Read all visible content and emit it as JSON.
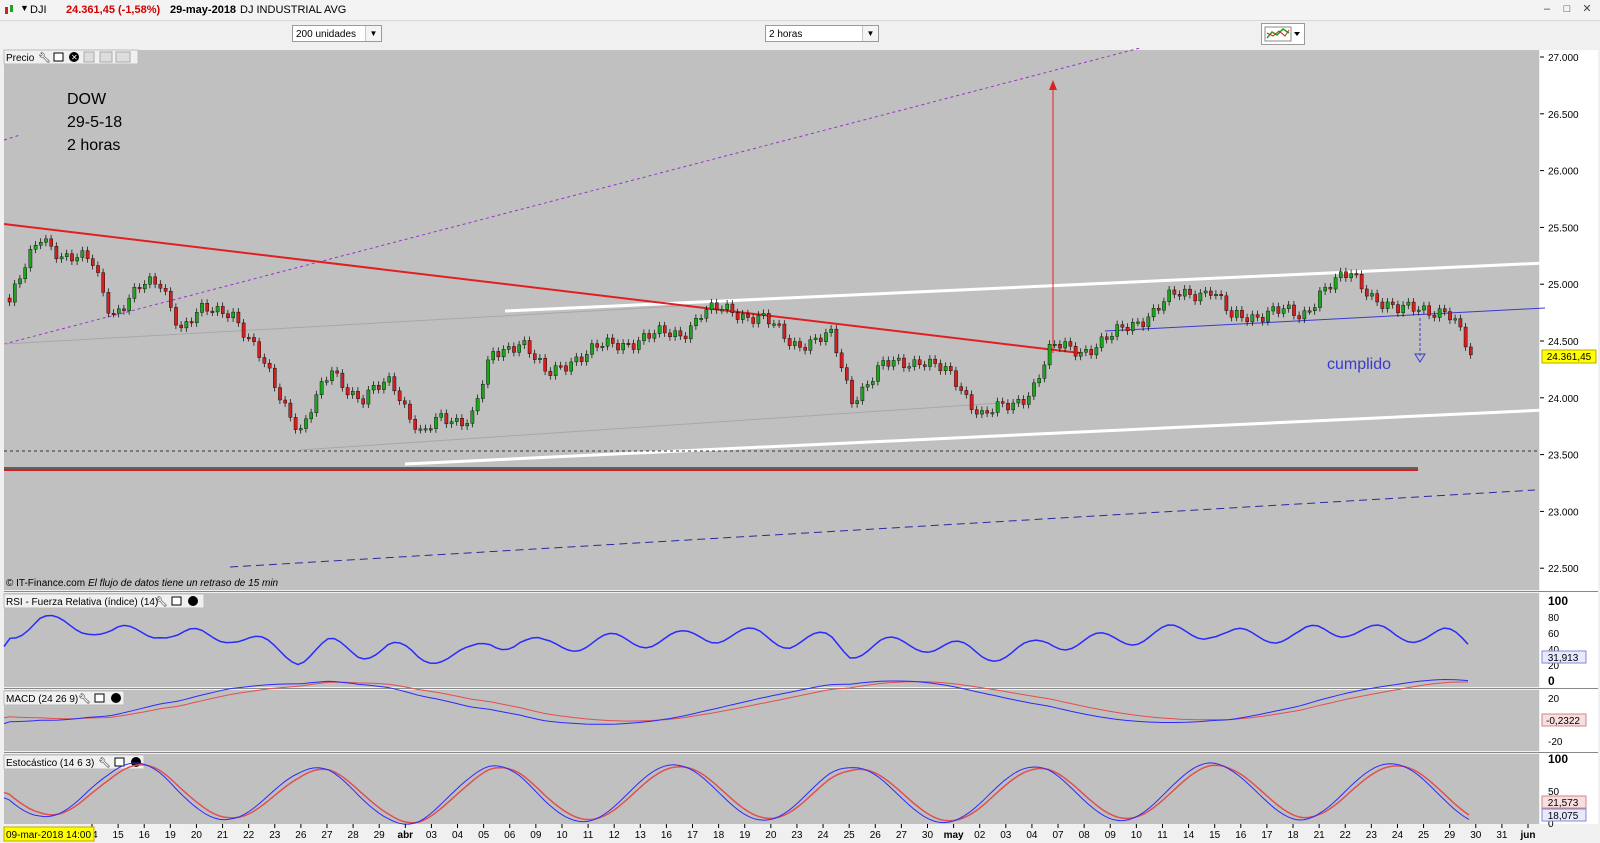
{
  "window": {
    "symbol": "DJI",
    "price_change": "24.361,45 (-1,58%)",
    "date": "29-may-2018",
    "instrument_name": "DJ INDUSTRIAL AVG"
  },
  "toolbar": {
    "units_select": "200 unidades",
    "interval_select": "2 horas",
    "chart_type_icon": "candlestick-chart-icon"
  },
  "price_panel": {
    "title": "Precio",
    "annotation_lines": [
      "DOW",
      "29-5-18",
      "2 horas"
    ],
    "callout": "cumplido",
    "current_price_label": "24.361,45",
    "footer_source": "© IT-Finance.com",
    "footer_note": "El flujo de datos tiene un retraso de 15 min",
    "y_ticks": [
      "27.000",
      "26.500",
      "26.000",
      "25.500",
      "25.000",
      "24.500",
      "24.000",
      "23.500",
      "23.000",
      "22.500"
    ]
  },
  "rsi_panel": {
    "title": "RSI - Fuerza Relativa (índice) (14)",
    "value_label": "31,913",
    "y_ticks": [
      "100",
      "80",
      "60",
      "40",
      "20",
      "0"
    ]
  },
  "macd_panel": {
    "title": "MACD (24 26 9)",
    "value_label": "-0,2322",
    "y_ticks": [
      "20",
      "-20"
    ]
  },
  "stoch_panel": {
    "title": "Estocástico (14 6 3)",
    "value_label_1": "21,573",
    "value_label_2": "18,075",
    "y_ticks": [
      "100",
      "50",
      "0"
    ]
  },
  "x_axis": {
    "cursor_label": "09-mar-2018 14:00",
    "ticks": [
      "14",
      "15",
      "16",
      "19",
      "20",
      "21",
      "22",
      "23",
      "26",
      "27",
      "28",
      "29",
      "abr",
      "03",
      "04",
      "05",
      "06",
      "09",
      "10",
      "11",
      "12",
      "13",
      "16",
      "17",
      "18",
      "19",
      "20",
      "23",
      "24",
      "25",
      "26",
      "27",
      "30",
      "may",
      "02",
      "03",
      "04",
      "07",
      "08",
      "09",
      "10",
      "11",
      "14",
      "15",
      "16",
      "17",
      "18",
      "21",
      "22",
      "23",
      "24",
      "25",
      "29",
      "30",
      "31",
      "jun"
    ]
  },
  "colors": {
    "chart_bg": "#c0c0c0",
    "bull_candle": "#1fa31f",
    "bear_candle": "#d02020",
    "trendline_red": "#e02020",
    "channel_white": "#ffffff",
    "rsi_line": "#2a2aff",
    "signal_line": "#e05050",
    "annotation_blue": "#3a3ad0",
    "price_label_bg": "#ffff00"
  }
}
